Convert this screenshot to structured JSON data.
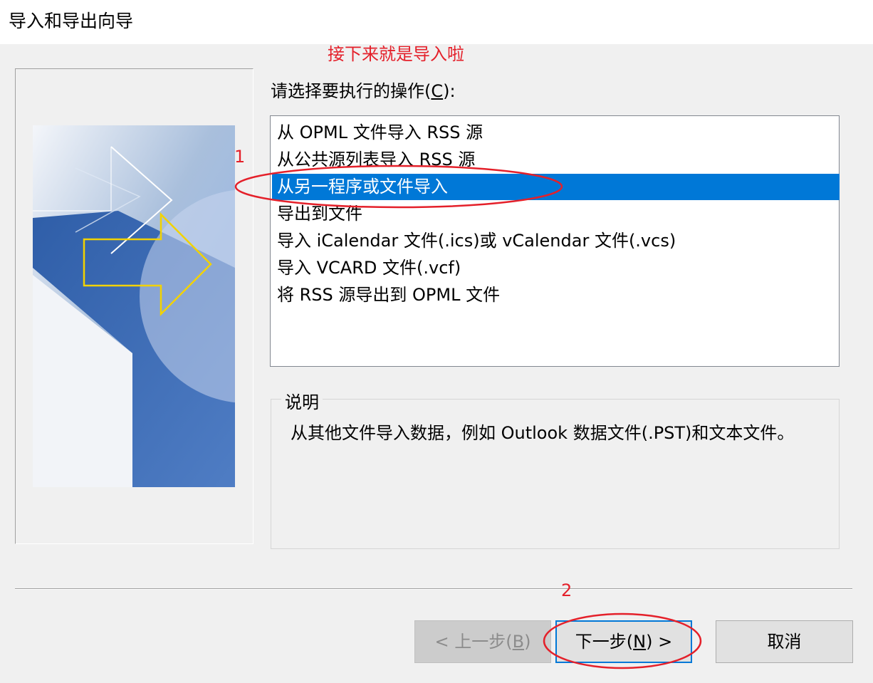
{
  "window": {
    "title": "导入和导出向导"
  },
  "annotations": {
    "top_note": "接下来就是导入啦",
    "step1": "1",
    "step2": "2"
  },
  "prompt": {
    "label_pre": "请选择要执行的操作(",
    "label_key": "C",
    "label_post": "):"
  },
  "actions": [
    {
      "label": "从 OPML 文件导入 RSS 源",
      "selected": false
    },
    {
      "label": "从公共源列表导入 RSS 源",
      "selected": false
    },
    {
      "label": "从另一程序或文件导入",
      "selected": true
    },
    {
      "label": "导出到文件",
      "selected": false
    },
    {
      "label": "导入 iCalendar 文件(.ics)或 vCalendar 文件(.vcs)",
      "selected": false
    },
    {
      "label": "导入 VCARD 文件(.vcf)",
      "selected": false
    },
    {
      "label": "将 RSS 源导出到 OPML 文件",
      "selected": false
    }
  ],
  "description": {
    "label": "说明",
    "text": "从其他文件导入数据，例如 Outlook 数据文件(.PST)和文本文件。"
  },
  "buttons": {
    "back": {
      "pre": "< 上一步(",
      "key": "B",
      "post": ")"
    },
    "next": {
      "pre": "下一步(",
      "key": "N",
      "post": ") >"
    },
    "cancel": "取消"
  },
  "colors": {
    "selection": "#0078d7",
    "annotation": "#e4202a",
    "focus_border": "#0078d7"
  }
}
